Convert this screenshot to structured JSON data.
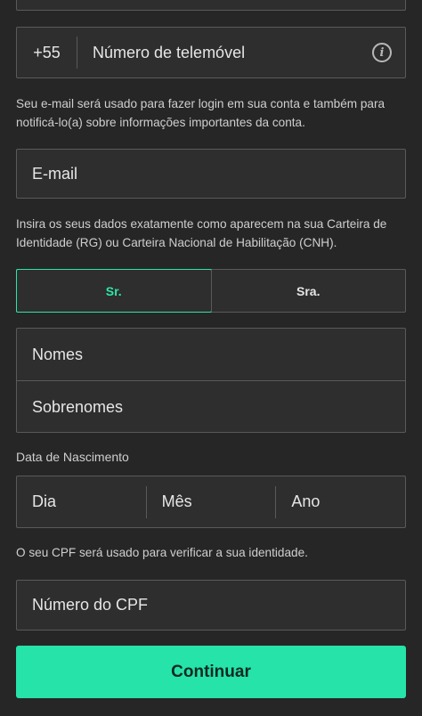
{
  "phone": {
    "country_code": "+55",
    "placeholder": "Número de telemóvel",
    "info_icon": "info-icon"
  },
  "email_note": "Seu e-mail será usado para fazer login em sua conta e também para notificá-lo(a) sobre informações importantes da conta.",
  "email": {
    "placeholder": "E-mail"
  },
  "id_note": "Insira os seus dados exatamente como aparecem na sua Carteira de Identidade (RG) ou Carteira Nacional de Habilitação (CNH).",
  "title_options": {
    "selected": "Sr.",
    "items": [
      "Sr.",
      "Sra."
    ]
  },
  "names": {
    "first_placeholder": "Nomes",
    "last_placeholder": "Sobrenomes"
  },
  "dob": {
    "label": "Data de Nascimento",
    "day": "Dia",
    "month": "Mês",
    "year": "Ano"
  },
  "cpf_note": "O seu CPF será usado para verificar a sua identidade.",
  "cpf": {
    "placeholder": "Número do CPF"
  },
  "continue_label": "Continuar",
  "colors": {
    "accent": "#26e3a9",
    "background": "#262626",
    "field": "#2e2e2e",
    "border": "#5a5a5a"
  }
}
